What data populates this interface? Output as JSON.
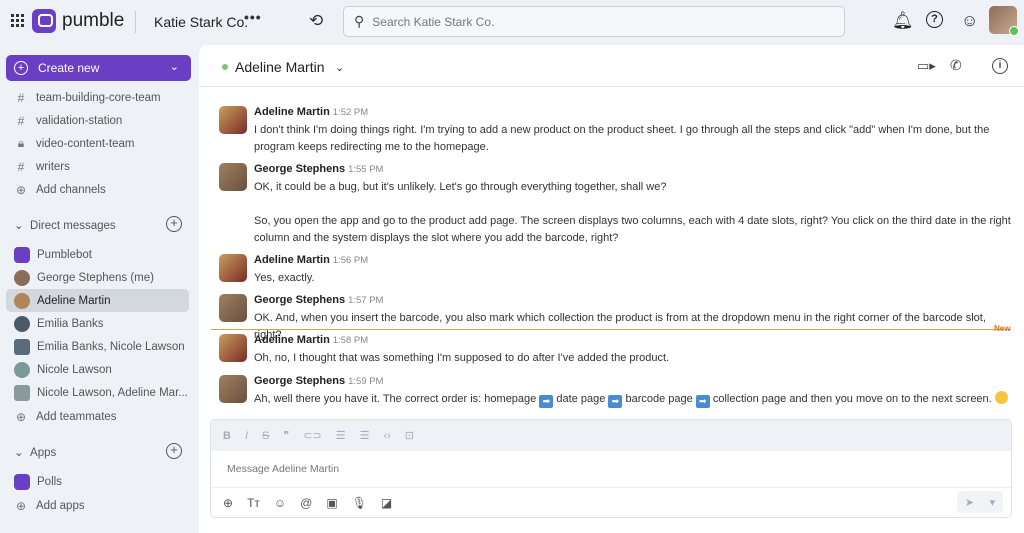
{
  "topbar": {
    "app_name": "pumble",
    "workspace": "Katie Stark Co.",
    "more": "•••",
    "search_placeholder": "Search Katie Stark Co."
  },
  "sidebar": {
    "create_label": "Create new",
    "channels": [
      {
        "label": "team-building-core-team",
        "icon": "hash"
      },
      {
        "label": "validation-station",
        "icon": "hash"
      },
      {
        "label": "video-content-team",
        "icon": "lock"
      },
      {
        "label": "writers",
        "icon": "hash"
      },
      {
        "label": "Add channels",
        "icon": "plus"
      }
    ],
    "dm_header": "Direct messages",
    "dms": [
      {
        "label": "Pumblebot"
      },
      {
        "label": "George Stephens (me)"
      },
      {
        "label": "Adeline Martin",
        "active": true
      },
      {
        "label": "Emilia Banks"
      },
      {
        "label": "Emilia Banks, Nicole Lawson"
      },
      {
        "label": "Nicole Lawson"
      },
      {
        "label": "Nicole Lawson, Adeline Mar..."
      },
      {
        "label": "Add teammates"
      }
    ],
    "apps_header": "Apps",
    "apps": [
      {
        "label": "Polls"
      },
      {
        "label": "Add apps"
      }
    ]
  },
  "channel": {
    "name": "Adeline Martin",
    "status_color": "#7ac771"
  },
  "messages": [
    {
      "author": "Adeline Martin",
      "time": "1:52 PM",
      "text": "I don't think I'm doing things right. I'm trying to add a new product on the product sheet. I go through all the steps and click \"add\" when I'm done, but the program keeps redirecting me to the homepage."
    },
    {
      "author": "George Stephens",
      "time": "1:55 PM",
      "text": "OK, it could be a bug, but it's unlikely. Let's go through everything together, shall we?",
      "text2": "So, you open the app and go to the product add page. The screen displays two columns, each with 4 date slots, right? You click on the third date in the right column and the system displays the slot where you add the barcode, right?"
    },
    {
      "author": "Adeline Martin",
      "time": "1:56 PM",
      "text": "Yes, exactly."
    },
    {
      "author": "George Stephens",
      "time": "1:57 PM",
      "text": "OK. And, when you insert the barcode, you also mark which collection the product is from at the dropdown menu in the right corner of the barcode slot, right?"
    },
    {
      "author": "Adeline Martin",
      "time": "1:58 PM",
      "text": "Oh, no, I thought that was something I'm supposed to do after I've added the product."
    },
    {
      "author": "George Stephens",
      "time": "1:59 PM",
      "parts": [
        "Ah, well there you have it. The correct order is: homepage",
        "date page",
        "barcode page",
        "collection page and then you move on to the next screen."
      ]
    }
  ],
  "new_label": "New",
  "composer": {
    "placeholder": "Message Adeline Martin"
  },
  "colors": {
    "brand": "#6b3fc4",
    "new_divider": "#c9a848"
  }
}
